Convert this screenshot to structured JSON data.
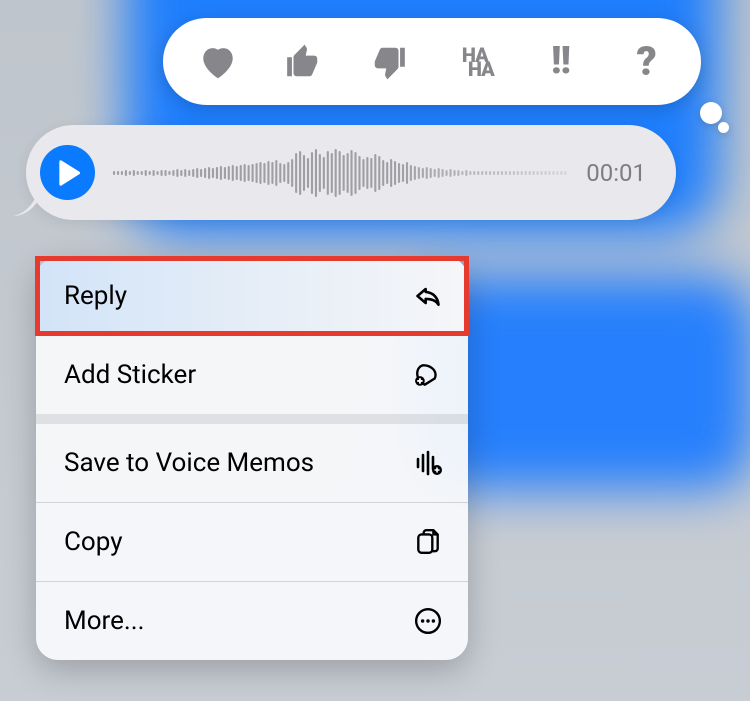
{
  "tapback": {
    "reactions": [
      "heart",
      "thumbs-up",
      "thumbs-down",
      "haha",
      "exclaim",
      "question"
    ],
    "haha_top": "HA",
    "haha_bottom": "HA",
    "exclaim_text": "!!",
    "question_text": "?"
  },
  "audio_message": {
    "duration_text": "00:01"
  },
  "context_menu": {
    "items": [
      {
        "label": "Reply",
        "icon": "reply-icon"
      },
      {
        "label": "Add Sticker",
        "icon": "sticker-icon"
      },
      {
        "label": "Save to Voice Memos",
        "icon": "voice-memos-icon"
      },
      {
        "label": "Copy",
        "icon": "copy-icon"
      },
      {
        "label": "More...",
        "icon": "more-icon"
      }
    ],
    "highlighted_index": 0
  },
  "colors": {
    "accent_blue": "#0a7aff",
    "gray_icon": "#86868b",
    "highlight_red": "#e53a2d"
  }
}
